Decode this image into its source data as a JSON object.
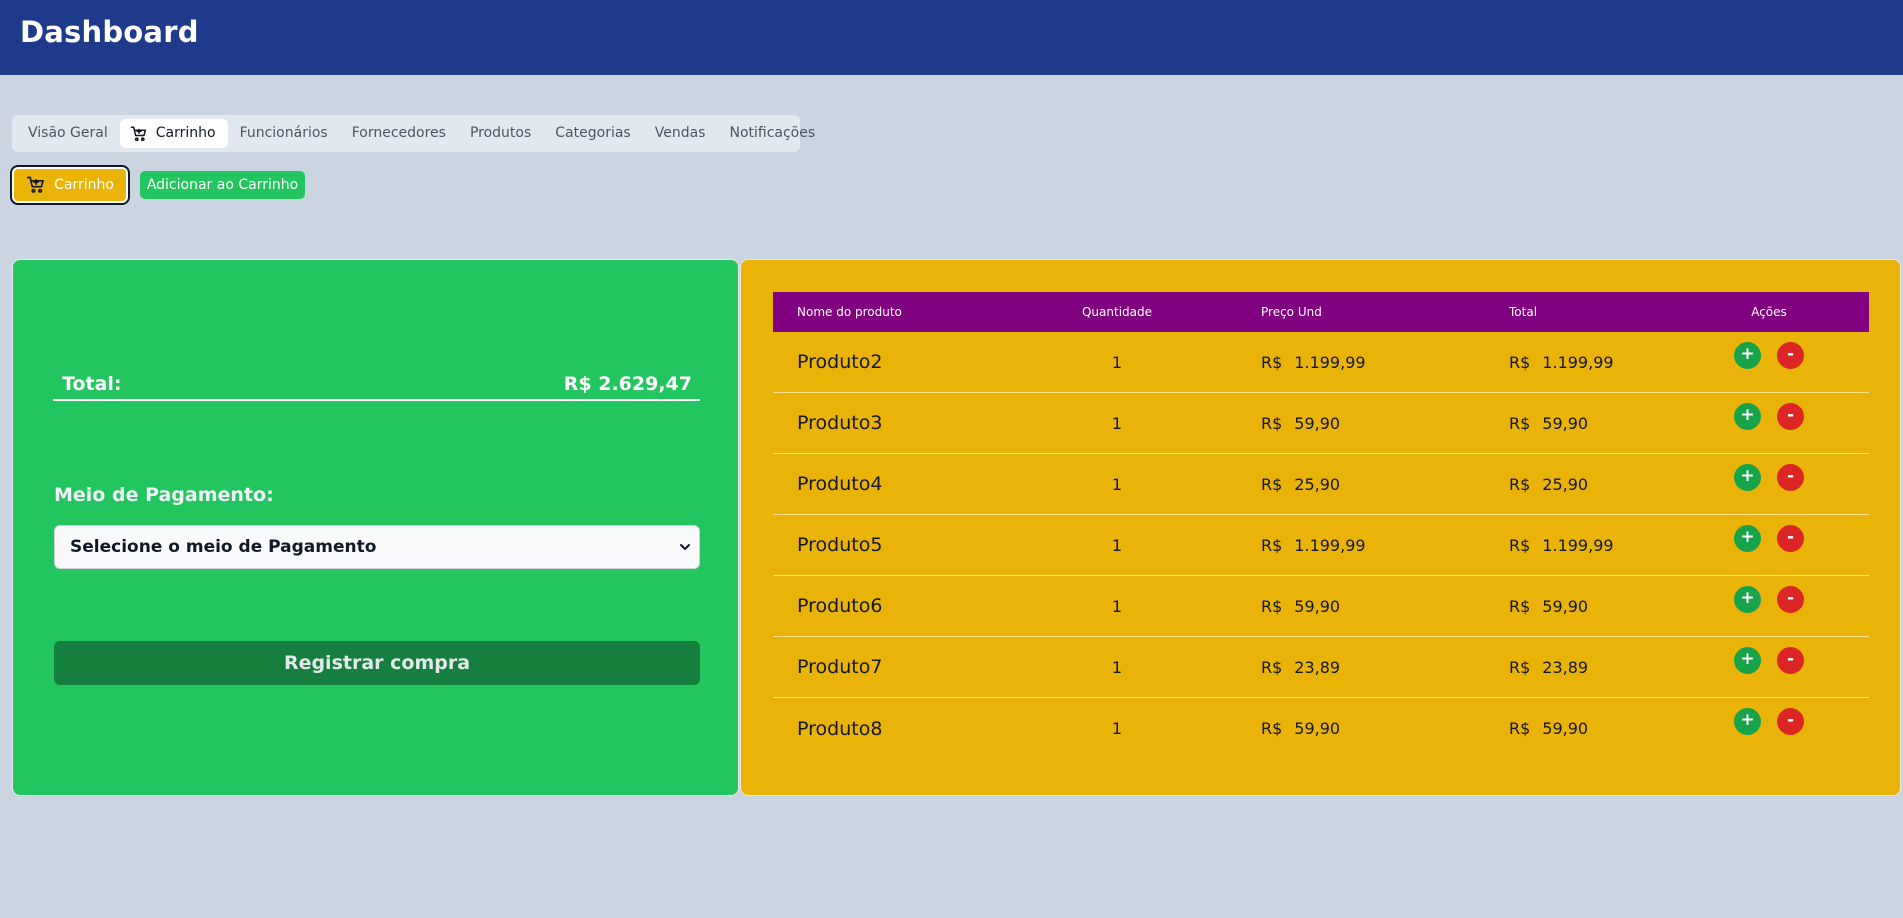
{
  "header": {
    "title": "Dashboard"
  },
  "tabs": [
    {
      "label": "Visão Geral",
      "active": false
    },
    {
      "label": "Carrinho",
      "active": true,
      "icon": "cart-icon"
    },
    {
      "label": "Funcionários",
      "active": false
    },
    {
      "label": "Fornecedores",
      "active": false
    },
    {
      "label": "Produtos",
      "active": false
    },
    {
      "label": "Categorias",
      "active": false
    },
    {
      "label": "Vendas",
      "active": false
    },
    {
      "label": "Notificações",
      "active": false
    }
  ],
  "actions": {
    "cart_label": "Carrinho",
    "add_label": "Adicionar ao Carrinho"
  },
  "summary": {
    "total_label": "Total:",
    "total_value": "R$ 2.629,47",
    "payment_label": "Meio de Pagamento:",
    "payment_selected": "Selecione o meio de Pagamento",
    "register_label": "Registrar compra"
  },
  "table": {
    "headers": [
      "Nome do produto",
      "Quantidade",
      "Preço Und",
      "Total",
      "Ações"
    ],
    "currency": "R$",
    "plus_symbol": "+",
    "minus_symbol": "-",
    "rows": [
      {
        "name": "Produto2",
        "qty": "1",
        "price": "1.199,99",
        "total": "1.199,99"
      },
      {
        "name": "Produto3",
        "qty": "1",
        "price": "59,90",
        "total": "59,90"
      },
      {
        "name": "Produto4",
        "qty": "1",
        "price": "25,90",
        "total": "25,90"
      },
      {
        "name": "Produto5",
        "qty": "1",
        "price": "1.199,99",
        "total": "1.199,99"
      },
      {
        "name": "Produto6",
        "qty": "1",
        "price": "59,90",
        "total": "59,90"
      },
      {
        "name": "Produto7",
        "qty": "1",
        "price": "23,89",
        "total": "23,89"
      },
      {
        "name": "Produto8",
        "qty": "1",
        "price": "59,90",
        "total": "59,90"
      }
    ]
  },
  "colors": {
    "header_bg": "#1e3a8a",
    "page_bg": "#cbd5e1",
    "summary_bg": "#22c55e",
    "table_panel_bg": "#eab308",
    "table_head_bg": "#800080",
    "register_bg": "#15803d",
    "plus_bg": "#16a34a",
    "minus_bg": "#dc2626"
  }
}
